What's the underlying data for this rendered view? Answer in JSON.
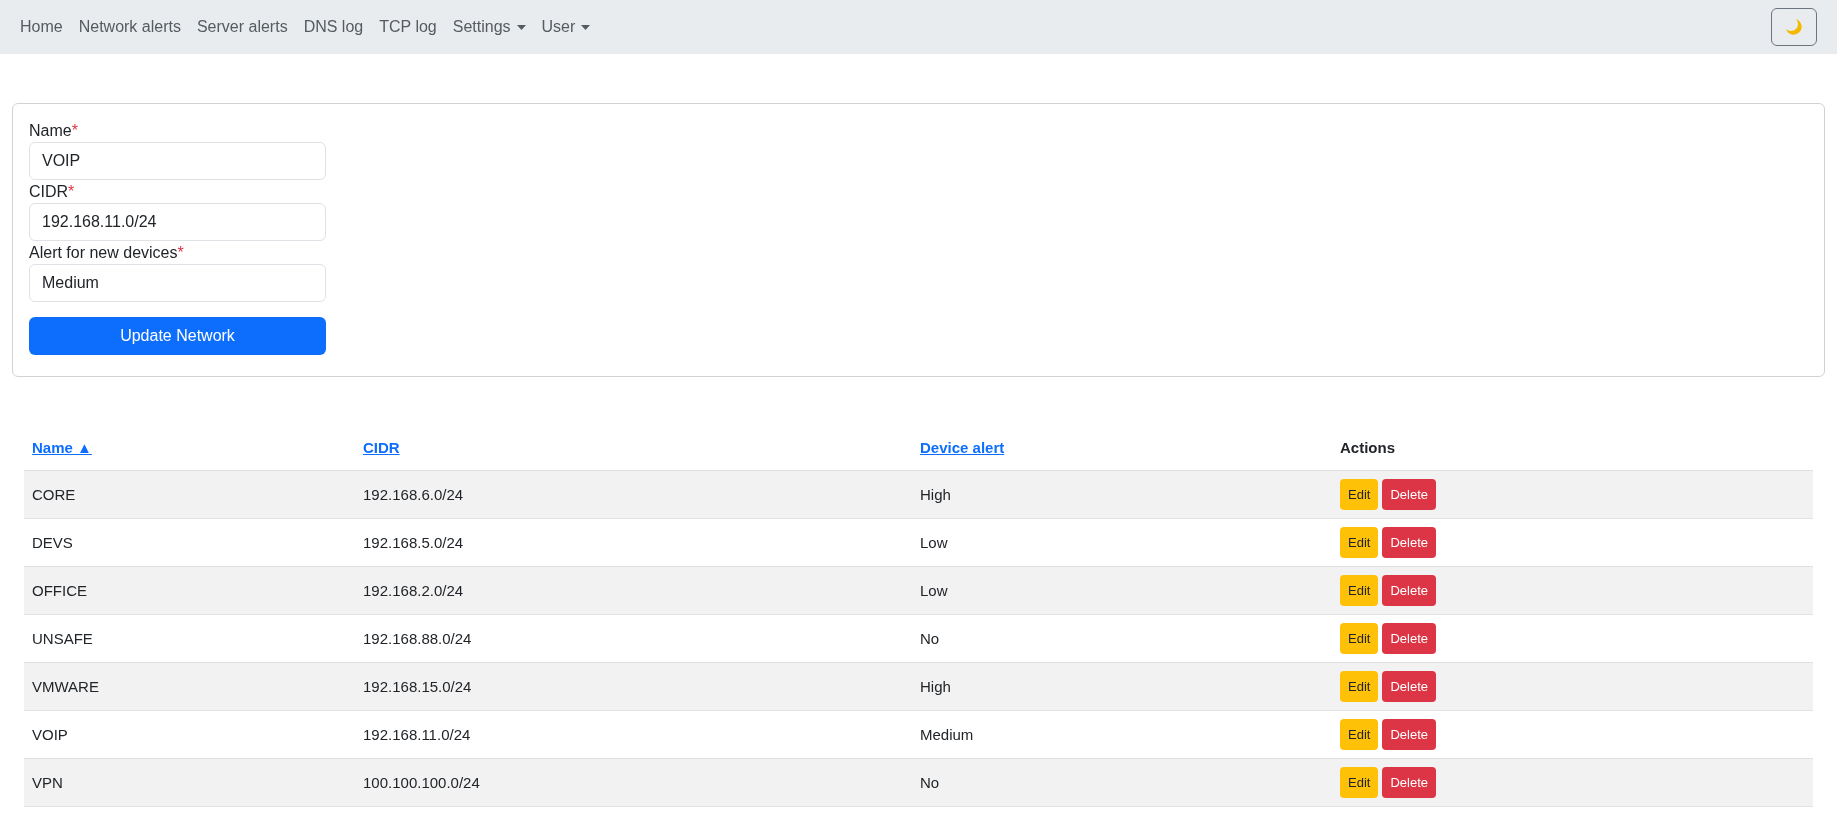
{
  "navbar": {
    "items": [
      {
        "label": "Home",
        "dropdown": false
      },
      {
        "label": "Network alerts",
        "dropdown": false
      },
      {
        "label": "Server alerts",
        "dropdown": false
      },
      {
        "label": "DNS log",
        "dropdown": false
      },
      {
        "label": "TCP log",
        "dropdown": false
      },
      {
        "label": "Settings",
        "dropdown": true
      },
      {
        "label": "User",
        "dropdown": true
      }
    ]
  },
  "form": {
    "fields": [
      {
        "label": "Name",
        "required_mark": "*",
        "value": "VOIP"
      },
      {
        "label": "CIDR",
        "required_mark": "*",
        "value": "192.168.11.0/24"
      },
      {
        "label": "Alert for new devices",
        "required_mark": "*",
        "value": "Medium"
      }
    ],
    "submit": "Update Network"
  },
  "table": {
    "columns": [
      {
        "label": "Name ▲",
        "kind": "link"
      },
      {
        "label": "CIDR",
        "kind": "link"
      },
      {
        "label": "Device alert",
        "kind": "link"
      },
      {
        "label": "Actions",
        "kind": "plain"
      }
    ],
    "rows": [
      {
        "name": "CORE",
        "cidr": "192.168.6.0/24",
        "alert": "High",
        "actions": [
          "Edit",
          "Delete"
        ]
      },
      {
        "name": "DEVS",
        "cidr": "192.168.5.0/24",
        "alert": "Low",
        "actions": [
          "Edit",
          "Delete"
        ]
      },
      {
        "name": "OFFICE",
        "cidr": "192.168.2.0/24",
        "alert": "Low",
        "actions": [
          "Edit",
          "Delete"
        ]
      },
      {
        "name": "UNSAFE",
        "cidr": "192.168.88.0/24",
        "alert": "No",
        "actions": [
          "Edit",
          "Delete"
        ]
      },
      {
        "name": "VMWARE",
        "cidr": "192.168.15.0/24",
        "alert": "High",
        "actions": [
          "Edit",
          "Delete"
        ]
      },
      {
        "name": "VOIP",
        "cidr": "192.168.11.0/24",
        "alert": "Medium",
        "actions": [
          "Edit",
          "Delete"
        ]
      },
      {
        "name": "VPN",
        "cidr": "100.100.100.0/24",
        "alert": "No",
        "actions": [
          "Edit",
          "Delete"
        ]
      }
    ]
  }
}
